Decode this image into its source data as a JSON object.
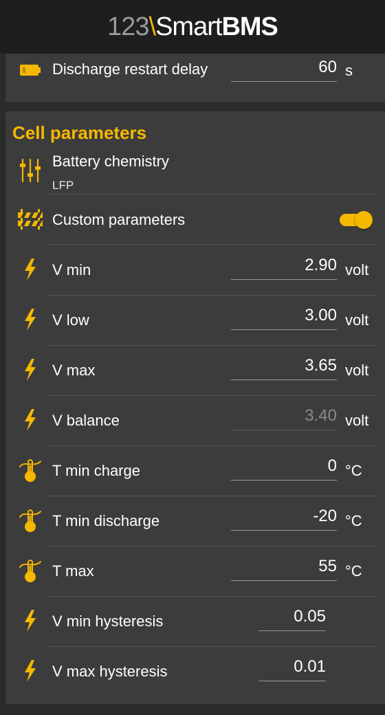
{
  "header": {
    "logo_num": "123",
    "logo_sep": "\\",
    "logo_smart": "Smart",
    "logo_bms": "BMS"
  },
  "top_card": {
    "label": "Discharge restart delay",
    "value": "60",
    "unit": "s",
    "icon": "battery-icon"
  },
  "cell_parameters": {
    "title": "Cell parameters",
    "chemistry": {
      "label": "Battery chemistry",
      "value": "LFP",
      "icon": "sliders-icon"
    },
    "custom": {
      "label": "Custom parameters",
      "enabled": true,
      "icon": "barrier-icon"
    },
    "rows": [
      {
        "label": "V min",
        "value": "2.90",
        "unit": "volt",
        "icon": "lightning-icon",
        "disabled": false
      },
      {
        "label": "V low",
        "value": "3.00",
        "unit": "volt",
        "icon": "lightning-icon",
        "disabled": false
      },
      {
        "label": "V max",
        "value": "3.65",
        "unit": "volt",
        "icon": "lightning-icon",
        "disabled": false
      },
      {
        "label": "V balance",
        "value": "3.40",
        "unit": "volt",
        "icon": "lightning-icon",
        "disabled": true
      },
      {
        "label": "T min charge",
        "value": "0",
        "unit": "°C",
        "icon": "thermometer-icon",
        "disabled": false
      },
      {
        "label": "T min discharge",
        "value": "-20",
        "unit": "°C",
        "icon": "thermometer-icon",
        "disabled": false
      },
      {
        "label": "T max",
        "value": "55",
        "unit": "°C",
        "icon": "thermometer-icon",
        "disabled": false
      },
      {
        "label": "V min hysteresis",
        "value": "0.05",
        "unit": "",
        "icon": "lightning-icon",
        "disabled": false
      },
      {
        "label": "V max hysteresis",
        "value": "0.01",
        "unit": "",
        "icon": "lightning-icon",
        "disabled": false
      }
    ]
  },
  "colors": {
    "accent": "#f5b800",
    "background": "#2b2b2b",
    "card": "#3c3c3c",
    "header": "#1e1e1e"
  }
}
